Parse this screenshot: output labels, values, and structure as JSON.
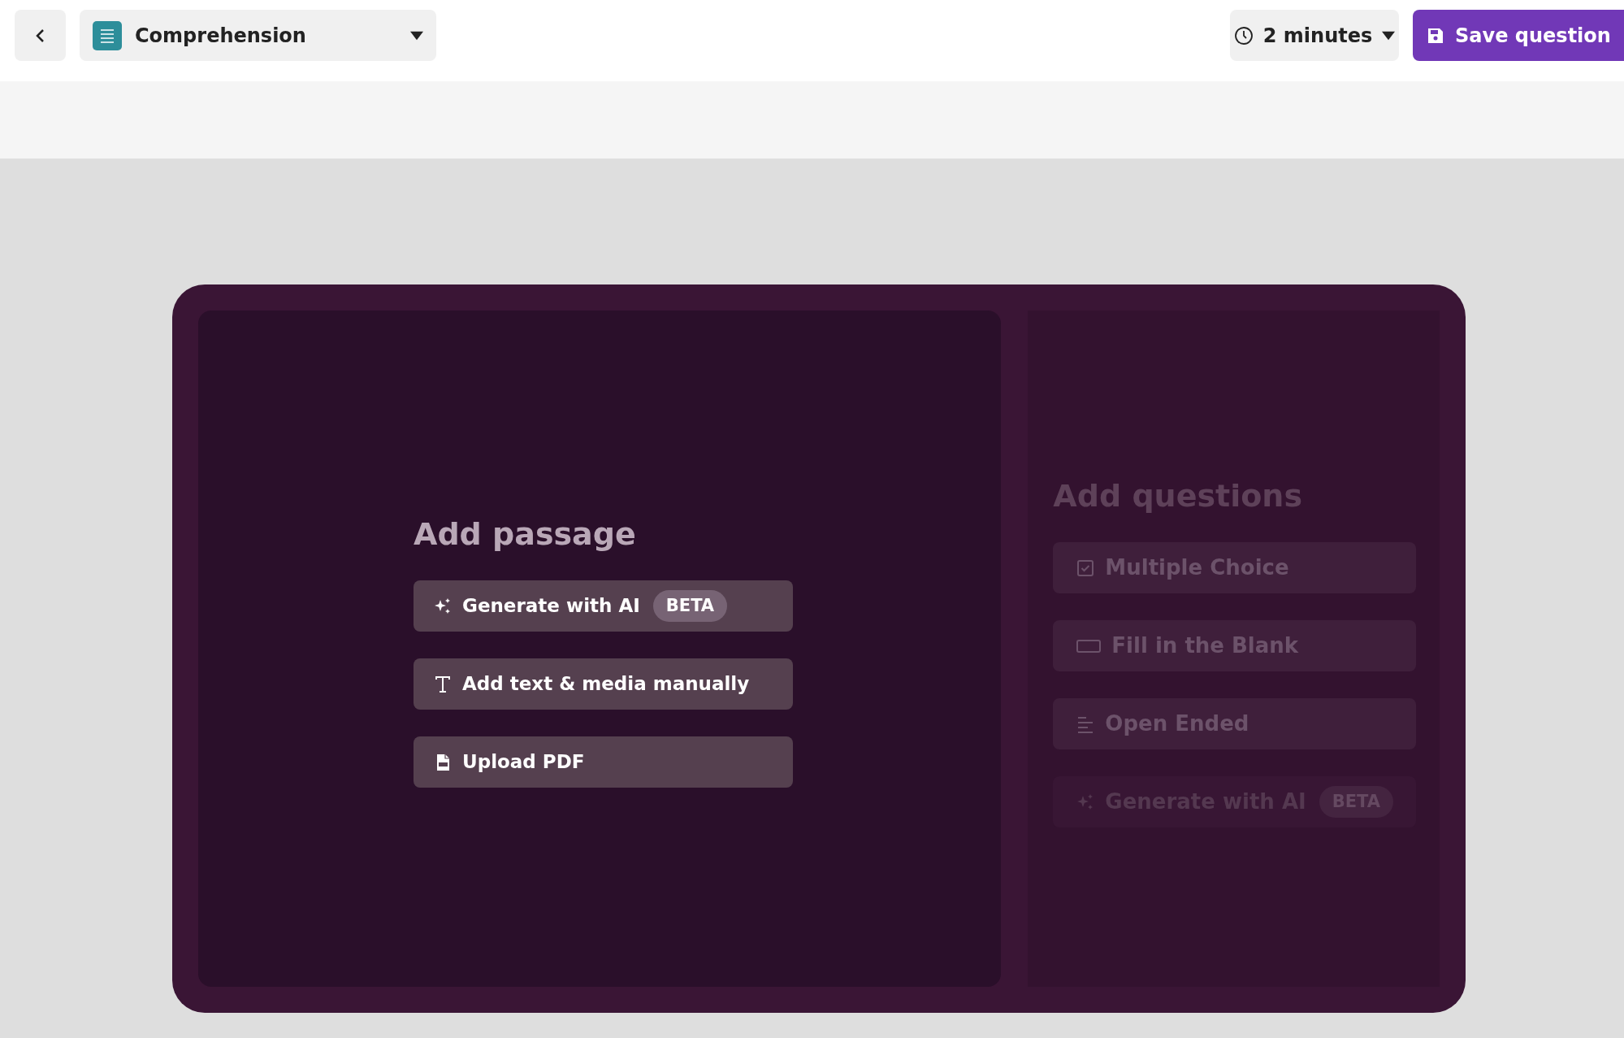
{
  "header": {
    "quiz_type": {
      "label": "Comprehension"
    },
    "timer": {
      "label": "2 minutes"
    },
    "save_button": {
      "label": "Save question"
    }
  },
  "passage": {
    "title": "Add passage",
    "options": [
      {
        "kind": "ai",
        "label": "Generate with AI",
        "badge": "BETA"
      },
      {
        "kind": "text",
        "label": "Add text & media manually"
      },
      {
        "kind": "pdf",
        "label": "Upload PDF"
      }
    ]
  },
  "questions": {
    "title": "Add questions",
    "options": [
      {
        "kind": "checkbox",
        "label": "Multiple Choice",
        "disabled": false
      },
      {
        "kind": "blank",
        "label": "Fill in the Blank",
        "disabled": false
      },
      {
        "kind": "lines",
        "label": "Open Ended",
        "disabled": false
      },
      {
        "kind": "ai",
        "label": "Generate with AI",
        "badge": "BETA",
        "disabled": true
      }
    ]
  }
}
